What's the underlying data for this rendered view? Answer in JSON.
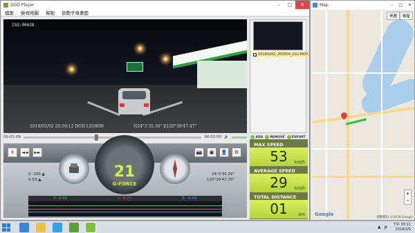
{
  "player": {
    "title": "DOD Player",
    "menu": [
      "檔案",
      "檢視地圖",
      "幫助",
      "自動子母畫面"
    ],
    "video": {
      "iso_text": "ISO:00628",
      "overlay_left": "2018/02/02 20:59:12 DOD LS590W",
      "overlay_right": "N24°3'35.30\" E120°39'47.47\""
    },
    "seek": {
      "current": "00:01:09",
      "end": "00:02:00"
    },
    "thumb": {
      "filename": "20180202_205804_022.MOV",
      "checked": true
    },
    "thumb_buttons": [
      "ADD",
      "REMOVE",
      "EXPORT"
    ],
    "controls": {
      "pause": "II",
      "rewind": "◄◄",
      "forward": "►►"
    },
    "g_force": {
      "value": "21",
      "label": "G-FORCE"
    },
    "tilt_left": {
      "line1": "0 -100 ▲",
      "line2": "0-53 ▲"
    },
    "coords": {
      "lat": "24°3'35.29\"",
      "lon": "120°39'47.70\""
    },
    "axes": {
      "x": "X: 0.02",
      "y": "Y: -0.27",
      "z": "Z: -0.05"
    },
    "stats": [
      {
        "label": "MAX SPEED",
        "value": "53",
        "unit": "km/h"
      },
      {
        "label": "AVERAGE SPEED",
        "value": "29",
        "unit": "km/h"
      },
      {
        "label": "TOTAL DISTANCE",
        "value": "01",
        "unit": "km"
      }
    ]
  },
  "map": {
    "title": "Map",
    "type_buttons": [
      "地圖",
      "衛星"
    ],
    "zoom_in": "+",
    "zoom_out": "−",
    "brand": "Google",
    "copyright": "地圖資料 ©2018 Google"
  },
  "taskbar": {
    "time": "下午 03:11",
    "date": "2018/2/5"
  },
  "colors": {
    "accent_green": "#d6f04a",
    "track_green": "#26c33a",
    "pin_red": "#e23b3b"
  }
}
